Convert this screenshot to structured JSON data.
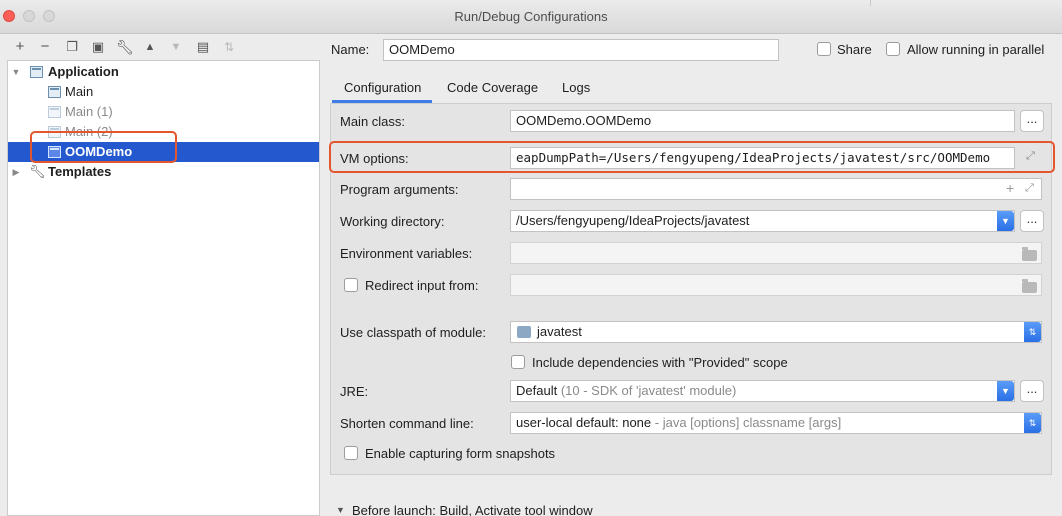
{
  "window": {
    "title": "Run/Debug Configurations"
  },
  "toolbar": {
    "icons": [
      "plus-icon",
      "minus-icon",
      "copy-icon",
      "save-icon",
      "wrench-icon",
      "move-up-icon",
      "move-down-icon",
      "folder-add-icon",
      "sort-icon"
    ]
  },
  "tree": {
    "application": {
      "label": "Application"
    },
    "items": [
      {
        "label": "Main"
      },
      {
        "label": "Main (1)"
      },
      {
        "label": "Main (2)"
      },
      {
        "label": "OOMDemo"
      }
    ],
    "templates": {
      "label": "Templates"
    },
    "selected": "OOMDemo"
  },
  "header": {
    "name_label": "Name:",
    "name_value": "OOMDemo",
    "share_label": "Share",
    "allow_parallel_label": "Allow running in parallel"
  },
  "tabs": [
    {
      "label": "Configuration"
    },
    {
      "label": "Code Coverage"
    },
    {
      "label": "Logs"
    }
  ],
  "form": {
    "main_class": {
      "label": "Main class:",
      "value": "OOMDemo.OOMDemo"
    },
    "vm_options": {
      "label": "VM options:",
      "value": "eapDumpPath=/Users/fengyupeng/IdeaProjects/javatest/src/OOMDemo"
    },
    "program_arguments": {
      "label": "Program arguments:",
      "value": ""
    },
    "working_directory": {
      "label": "Working directory:",
      "value": "/Users/fengyupeng/IdeaProjects/javatest"
    },
    "environment_variables": {
      "label": "Environment variables:",
      "value": ""
    },
    "redirect_input": {
      "label": "Redirect input from:",
      "value": ""
    },
    "classpath_module": {
      "label": "Use classpath of module:",
      "value": "javatest"
    },
    "include_provided": {
      "label": "Include dependencies with \"Provided\" scope"
    },
    "jre": {
      "label": "JRE:",
      "value": "Default",
      "hint": "(10 - SDK of 'javatest' module)"
    },
    "shorten_command_line": {
      "label": "Shorten command line:",
      "value": "user-local default: none",
      "hint": "- java [options] classname [args]"
    },
    "capture_snapshots": {
      "label": "Enable capturing form snapshots"
    },
    "dots": "..."
  },
  "before_launch": {
    "label": "Before launch: Build, Activate tool window"
  },
  "colors": {
    "selection": "#2458cf",
    "highlight": "#e4572e",
    "accent": "#3d7ee8"
  }
}
